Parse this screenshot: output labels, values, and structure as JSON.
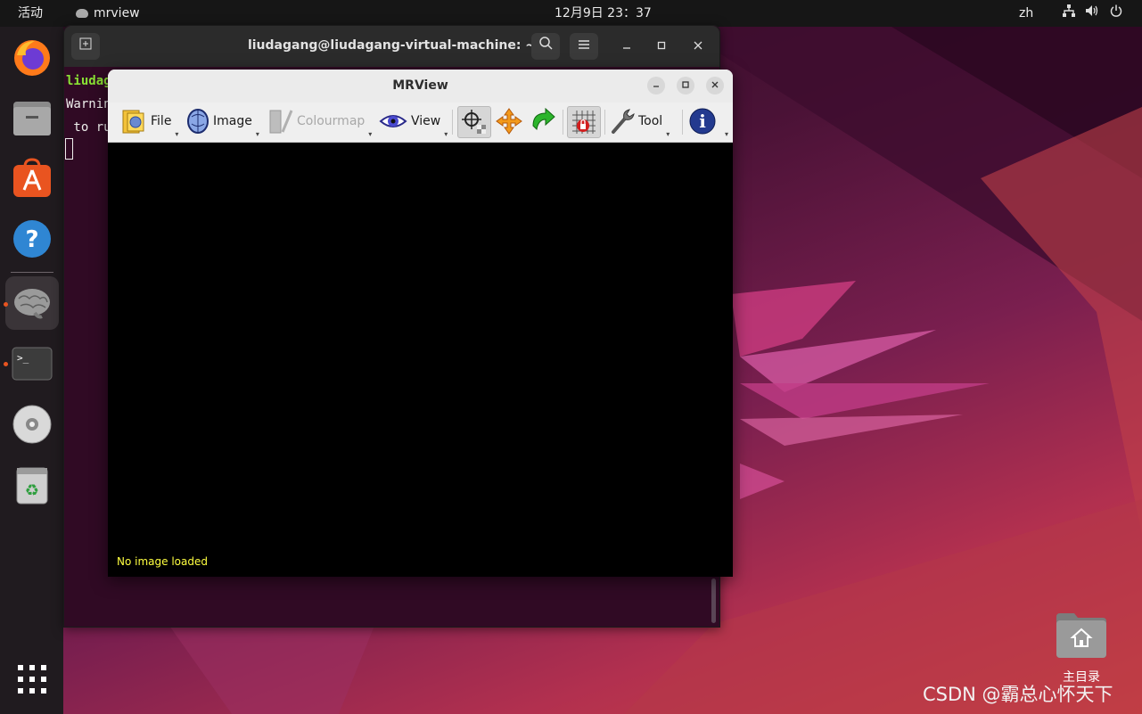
{
  "topbar": {
    "activities": "活动",
    "app_name": "mrview",
    "clock": "12月9日  23：37",
    "language": "zh",
    "tray_icons": [
      "network-icon",
      "volume-icon",
      "power-icon"
    ]
  },
  "dock": {
    "items": [
      {
        "name": "firefox-icon"
      },
      {
        "name": "files-icon"
      },
      {
        "name": "software-icon"
      },
      {
        "name": "help-icon"
      },
      {
        "name": "mrview-brain-icon",
        "running": true,
        "active": true
      },
      {
        "name": "terminal-icon",
        "running": true
      },
      {
        "name": "disc-icon"
      },
      {
        "name": "trash-icon"
      }
    ],
    "show_apps": "show-applications-icon"
  },
  "terminal": {
    "title": "liudagang@liudagang-virtual-machine: ~",
    "lines": [
      "liudagang",
      "Warnin",
      " to ru"
    ],
    "prompt_color": "#8ae234"
  },
  "mrview": {
    "title": "MRView",
    "toolbar": {
      "file": "File",
      "image": "Image",
      "colourmap": "Colourmap",
      "view": "View",
      "tool": "Tool"
    },
    "status": "No image loaded"
  },
  "desktop": {
    "home_label": "主目录",
    "watermark": "CSDN @霸总心怀天下"
  }
}
